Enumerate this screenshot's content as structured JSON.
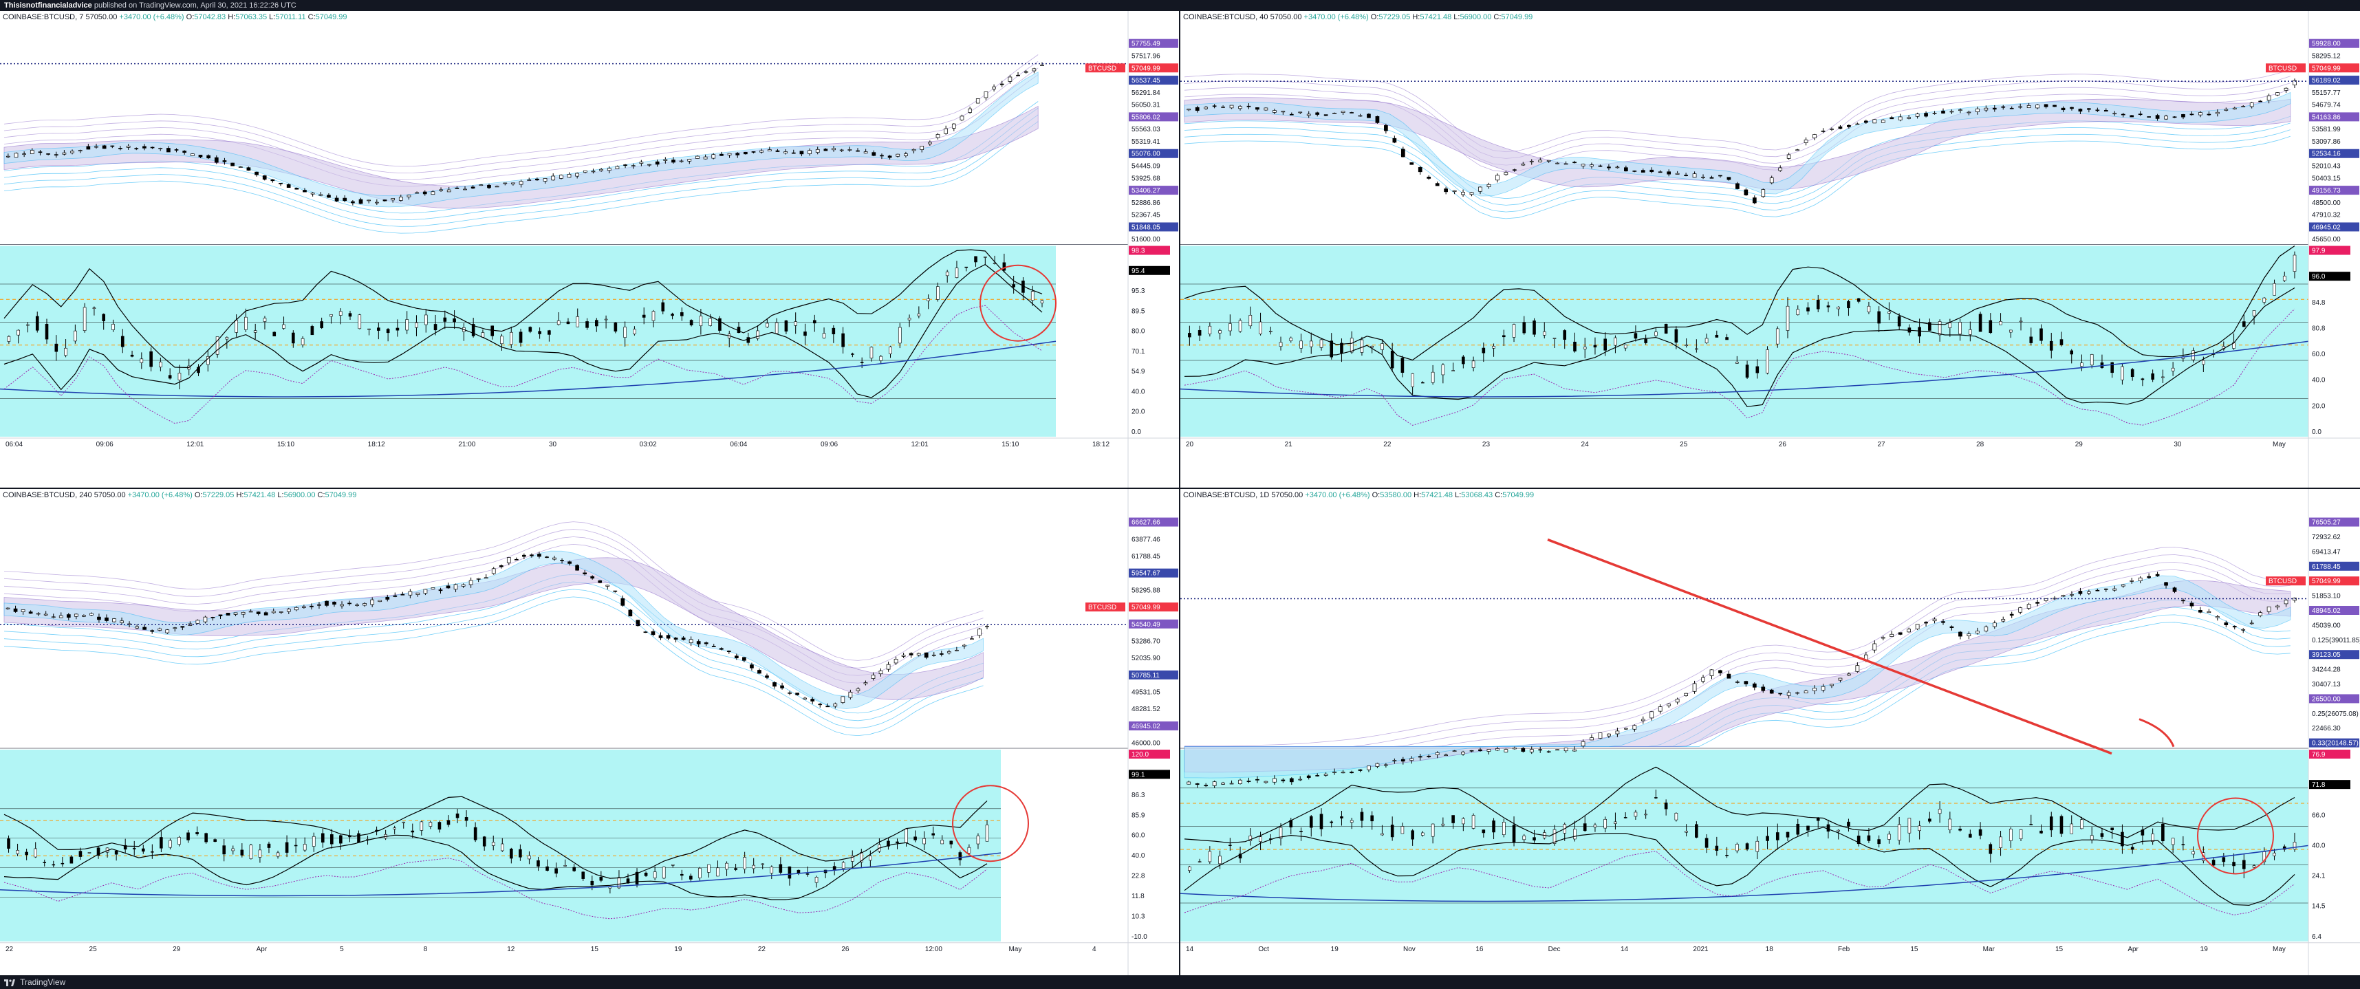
{
  "header": {
    "author": "Thisisnotfinancialadvice",
    "published_text": "published on TradingView.com, April 30, 2021 16:22:26 UTC"
  },
  "footer": {
    "brand": "TradingView"
  },
  "colors": {
    "background": "#131722",
    "up": "#26a69a",
    "down": "#ef5350",
    "candle": "#000000",
    "band_purple": "#b39ddb",
    "band_blue": "#4fc3f7",
    "oscillator_bg": "#b2f5f5",
    "price_tag": "#f23645",
    "annotation": "#e53935"
  },
  "panels": [
    {
      "id": "tl",
      "symbol": "COINBASE:BTCUSD",
      "interval": "7",
      "last": "57050.00",
      "change": "+3470.00 (+6.48%)",
      "o": "57042.83",
      "h": "57063.35",
      "l": "57011.11",
      "c": "57049.99",
      "price_labels": [
        "57755.49",
        "57517.96",
        "57049.99",
        "56537.45",
        "56291.84",
        "56050.31",
        "55806.02",
        "55563.03",
        "55319.41",
        "55076.00",
        "54445.09",
        "53925.68",
        "53406.27",
        "52886.86",
        "52367.45",
        "51848.05",
        "51600.00"
      ],
      "osc_labels": [
        "98.3",
        "95.4",
        "95.3",
        "89.5",
        "80.0",
        "70.1",
        "54.9",
        "40.0",
        "20.0",
        "0.0"
      ],
      "time_labels": [
        "06:04",
        "09:06",
        "12:01",
        "15:10",
        "18:12",
        "21:00",
        "30",
        "03:02",
        "06:04",
        "09:06",
        "12:01",
        "15:10",
        "18:12"
      ],
      "chart_data": {
        "type": "candlestick",
        "series": [
          {
            "name": "BTCUSD",
            "values": [
              54200,
              54400,
              54300,
              54550,
              54500,
              54480,
              54350,
              54150,
              53900,
              53500,
              53200,
              52950,
              52850,
              52900,
              53100,
              53200,
              53300,
              53400,
              53500,
              53650,
              53800,
              53950,
              54050,
              54150,
              54250,
              54350,
              54400,
              54350,
              54450,
              54350,
              54200,
              54500,
              55200,
              56100,
              56650,
              57050
            ]
          }
        ],
        "ylim": [
          51600,
          57760
        ],
        "oscillator": {
          "values": [
            50,
            62,
            45,
            70,
            48,
            38,
            30,
            45,
            60,
            58,
            52,
            65,
            60,
            55,
            58,
            62,
            55,
            50,
            56,
            62,
            58,
            55,
            66,
            60,
            58,
            52,
            60,
            58,
            55,
            40,
            50,
            70,
            88,
            95,
            80,
            70
          ],
          "ylim": [
            0,
            100
          ]
        },
        "annotations": [
          "circle"
        ]
      }
    },
    {
      "id": "tr",
      "symbol": "COINBASE:BTCUSD",
      "interval": "40",
      "last": "57050.00",
      "change": "+3470.00 (+6.48%)",
      "o": "57229.05",
      "h": "57421.48",
      "l": "56900.00",
      "c": "57049.99",
      "price_labels": [
        "59928.00",
        "58295.12",
        "57049.99",
        "56189.02",
        "55157.77",
        "54679.74",
        "54163.86",
        "53581.99",
        "53097.86",
        "52534.16",
        "52010.43",
        "50403.15",
        "49156.73",
        "48500.00",
        "47910.32",
        "46945.02",
        "45650.00"
      ],
      "osc_labels": [
        "97.9",
        "96.0",
        "84.8",
        "80.8",
        "60.0",
        "40.0",
        "20.0",
        "0.0"
      ],
      "time_labels": [
        "20",
        "21",
        "22",
        "23",
        "24",
        "25",
        "26",
        "27",
        "28",
        "29",
        "30",
        "May"
      ],
      "chart_data": {
        "type": "candlestick",
        "series": [
          {
            "name": "BTCUSD",
            "values": [
              55000,
              55300,
              55200,
              54900,
              54700,
              54800,
              54500,
              51500,
              49500,
              49000,
              50500,
              51500,
              51300,
              51000,
              50800,
              50600,
              50400,
              50300,
              48500,
              51800,
              53500,
              54000,
              54300,
              54600,
              54900,
              55000,
              55200,
              55300,
              55100,
              54900,
              54600,
              54500,
              54700,
              55000,
              55700,
              57050
            ]
          }
        ],
        "ylim": [
          45650,
          59930
        ],
        "oscillator": {
          "values": [
            52,
            55,
            60,
            50,
            48,
            45,
            52,
            30,
            35,
            40,
            55,
            58,
            50,
            48,
            52,
            55,
            50,
            48,
            30,
            65,
            70,
            68,
            62,
            58,
            56,
            60,
            58,
            52,
            40,
            38,
            30,
            35,
            42,
            50,
            75,
            92
          ],
          "ylim": [
            0,
            100
          ]
        },
        "annotations": []
      }
    },
    {
      "id": "bl",
      "symbol": "COINBASE:BTCUSD",
      "interval": "240",
      "last": "57050.00",
      "change": "+3470.00 (+6.48%)",
      "o": "57229.05",
      "h": "57421.48",
      "l": "56900.00",
      "c": "57049.99",
      "price_labels": [
        "66627.66",
        "63877.46",
        "61788.45",
        "59547.67",
        "58295.88",
        "57049.99",
        "54540.49",
        "53286.70",
        "52035.90",
        "50785.11",
        "49531.05",
        "48281.52",
        "46945.02",
        "46000.00"
      ],
      "osc_labels": [
        "120.0",
        "99.1",
        "86.3",
        "85.9",
        "60.0",
        "40.0",
        "22.8",
        "11.8",
        "10.3",
        "-10.0"
      ],
      "time_labels": [
        "22",
        "25",
        "29",
        "Apr",
        "5",
        "8",
        "12",
        "15",
        "19",
        "22",
        "26",
        "12:00",
        "May",
        "4"
      ],
      "chart_data": {
        "type": "candlestick",
        "series": [
          {
            "name": "BTCUSD",
            "values": [
              58500,
              58200,
              57800,
              58000,
              57500,
              56800,
              56500,
              57200,
              57800,
              58200,
              58000,
              58600,
              59000,
              58800,
              59200,
              59800,
              60200,
              60500,
              61200,
              63000,
              63500,
              62800,
              61500,
              60000,
              56500,
              55800,
              55500,
              55000,
              53500,
              51500,
              50500,
              49500,
              51000,
              53000,
              54500,
              54200,
              55000,
              57050
            ]
          }
        ],
        "ylim": [
          46000,
          66630
        ],
        "oscillator": {
          "values": [
            55,
            50,
            42,
            48,
            55,
            50,
            58,
            62,
            55,
            50,
            52,
            56,
            60,
            58,
            62,
            68,
            70,
            72,
            60,
            52,
            42,
            38,
            32,
            30,
            34,
            38,
            36,
            40,
            44,
            38,
            34,
            36,
            44,
            56,
            62,
            58,
            50,
            64
          ],
          "ylim": [
            -10,
            120
          ]
        },
        "annotations": [
          "circle"
        ]
      }
    },
    {
      "id": "br",
      "symbol": "COINBASE:BTCUSD",
      "interval": "1D",
      "last": "57050.00",
      "change": "+3470.00 (+6.48%)",
      "o": "53580.00",
      "h": "57421.48",
      "l": "53068.43",
      "c": "57049.99",
      "price_labels": [
        "76505.27",
        "72932.62",
        "69413.47",
        "61788.45",
        "57049.99",
        "51853.10",
        "48945.02",
        "45039.00",
        "0.125(39011.85)",
        "39123.05",
        "34244.28",
        "30407.13",
        "26500.00",
        "0.25(26075.08)",
        "22466.30",
        "0.33(20148.57)"
      ],
      "osc_labels": [
        "76.9",
        "71.8",
        "66.0",
        "40.0",
        "24.1",
        "14.5",
        "6.4"
      ],
      "time_labels": [
        "14",
        "Oct",
        "19",
        "Nov",
        "16",
        "Dec",
        "14",
        "2021",
        "18",
        "Feb",
        "15",
        "Mar",
        "15",
        "Apr",
        "19",
        "May"
      ],
      "chart_data": {
        "type": "candlestick",
        "series": [
          {
            "name": "BTCUSD",
            "values": [
              10800,
              10700,
              11200,
              11500,
              11800,
              13000,
              13800,
              15500,
              16800,
              18200,
              18500,
              19000,
              19200,
              18800,
              19500,
              23000,
              24500,
              29000,
              33000,
              39000,
              36000,
              34000,
              33000,
              35000,
              38000,
              47000,
              49000,
              52000,
              48000,
              50000,
              54000,
              57000,
              58500,
              59000,
              61000,
              63000,
              56000,
              53000,
              49000,
              54500,
              57050
            ]
          }
        ],
        "ylim": [
          20000,
          77000
        ],
        "oscillator": {
          "values": [
            40,
            45,
            48,
            55,
            60,
            62,
            66,
            58,
            55,
            60,
            64,
            60,
            56,
            52,
            58,
            64,
            70,
            72,
            60,
            50,
            48,
            56,
            60,
            62,
            56,
            52,
            60,
            66,
            58,
            50,
            55,
            62,
            60,
            56,
            52,
            58,
            50,
            42,
            38,
            44,
            55
          ],
          "ylim": [
            0,
            100
          ]
        },
        "annotations": [
          "downtrend-line",
          "circle"
        ]
      }
    }
  ]
}
